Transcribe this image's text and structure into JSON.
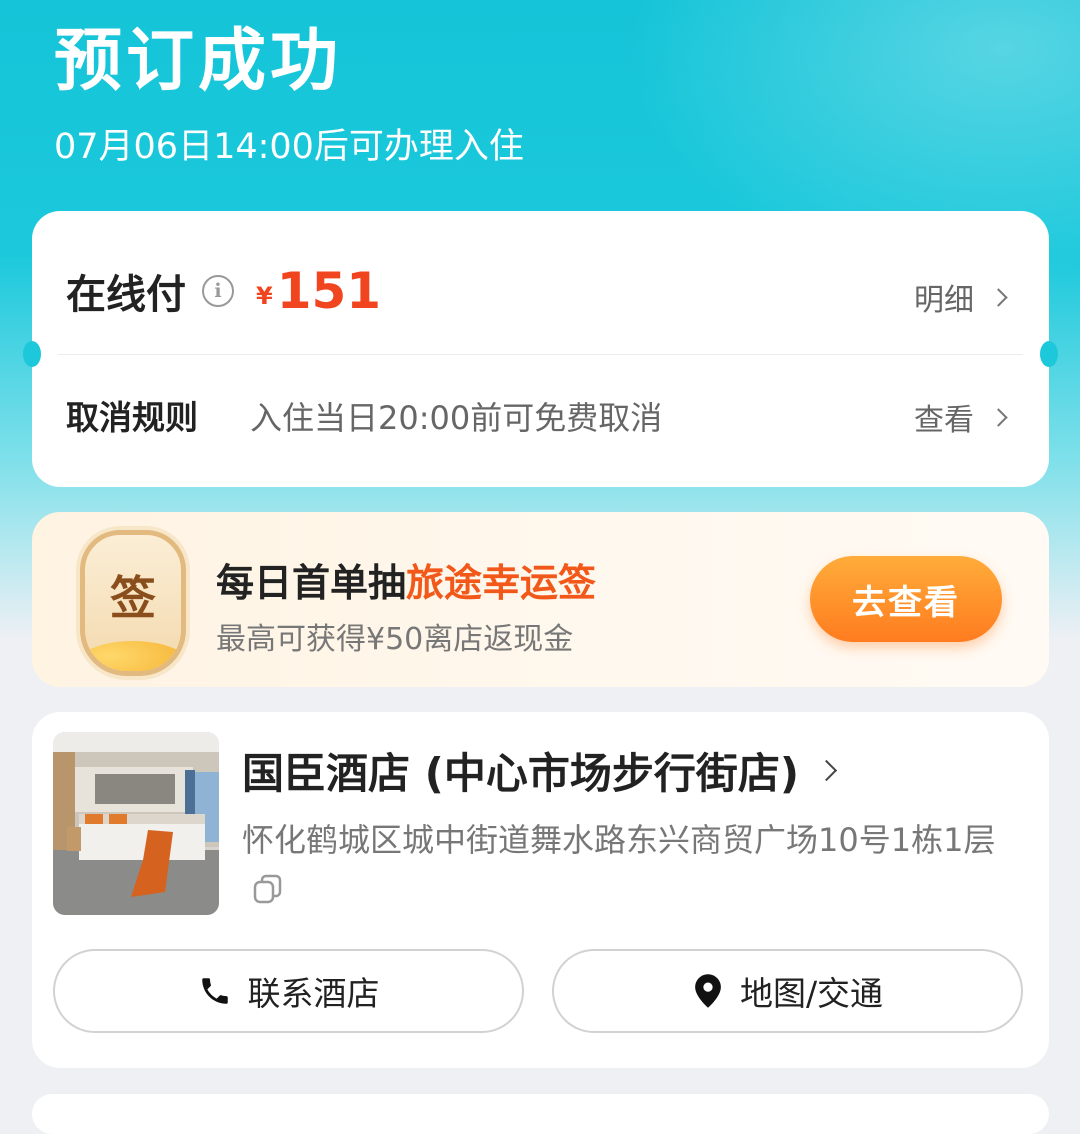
{
  "header": {
    "title": "预订成功",
    "checkin_note": "07月06日14:00后可办理入住"
  },
  "payment": {
    "label": "在线付",
    "currency": "¥",
    "amount": "151",
    "detail_link": "明细",
    "cancel_label": "取消规则",
    "cancel_policy": "入住当日20:00前可免费取消",
    "cancel_link": "查看"
  },
  "promo": {
    "badge": "签",
    "title_prefix": "每日首单抽",
    "title_highlight": "旅途幸运签",
    "subtitle": "最高可获得¥50离店返现金",
    "button": "去查看",
    "highlight_color": "#f2581a"
  },
  "hotel": {
    "name": "国臣酒店 (中心市场步行街店)",
    "address": "怀化鹤城区城中街道舞水路东兴商贸广场10号1栋1层",
    "call_button": "联系酒店",
    "map_button": "地图/交通"
  },
  "colors": {
    "brand": "#15c4d8",
    "price": "#f0451f",
    "button": "#ff8a24"
  }
}
